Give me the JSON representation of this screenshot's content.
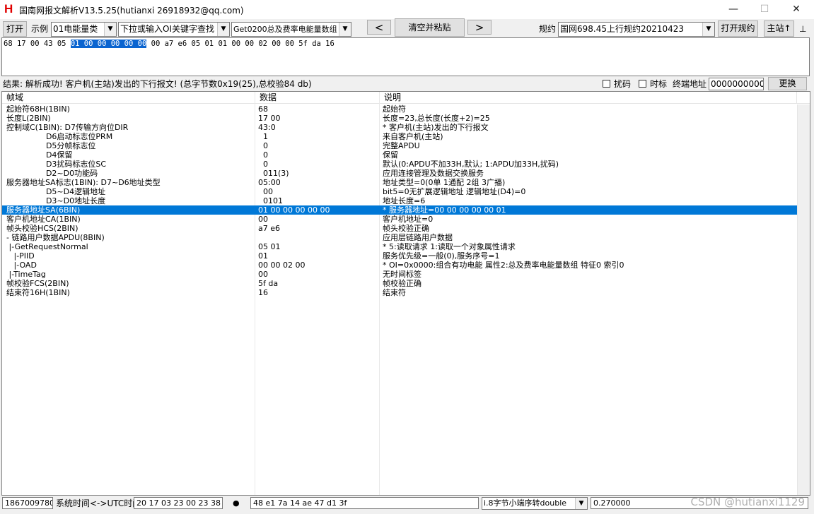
{
  "window": {
    "title": "国南网报文解析V13.5.25(hutianxi 26918932@qq.com)",
    "app_icon_letter": "H",
    "minimize": "—",
    "maximize": "☐",
    "close": "✕"
  },
  "toolbar": {
    "open_label": "打开",
    "example_label": "示例",
    "example_select": "01电能量类",
    "keyword_select": "下拉或输入OI关键字查找",
    "oi_select": "Get0200总及费率电能量数组",
    "prev_label": "<",
    "clear_paste_label": "清空并粘贴",
    "next_label": ">",
    "protocol_label": "规约",
    "protocol_select": "国网698.45上行规约20210423",
    "open_protocol_label": "打开规约",
    "master_label": "主站↑",
    "pin_label": "⊥"
  },
  "hex": {
    "before": "68 17 00 43 05 ",
    "selected": "01 00 00 00 00 00",
    "after": " 00 a7 e6 05 01 01 00 00 02 00 00 5f da 16"
  },
  "result": {
    "text": "结果: 解析成功! 客户机(主站)发出的下行报文! (总字节数0x19(25),总校验84 db)",
    "scramble_label": "扰码",
    "timetag_label": "时标",
    "terminal_addr_label": "终端地址",
    "terminal_addr_value": "000000000001",
    "replace_label": "更换"
  },
  "table": {
    "headers": [
      "帧域",
      "数据",
      "说明"
    ],
    "selected_index": 11,
    "rows": [
      [
        "起始符68H(1BIN)",
        "68",
        "起始符"
      ],
      [
        "长度L(2BIN)",
        "17 00",
        "长度=23,总长度(长度+2)=25"
      ],
      [
        "控制域C(1BIN): D7传输方向位DIR",
        "43:0",
        "* 客户机(主站)发出的下行报文"
      ],
      [
        "                D6启动标志位PRM",
        "  1",
        "来自客户机(主站)"
      ],
      [
        "                D5分帧标志位",
        "  0",
        "完整APDU"
      ],
      [
        "                D4保留",
        "  0",
        "保留"
      ],
      [
        "                D3扰码标志位SC",
        "  0",
        "默认(0:APDU不加33H,默认; 1:APDU加33H,扰码)"
      ],
      [
        "                D2~D0功能码",
        "  011(3)",
        "应用连接管理及数据交换服务"
      ],
      [
        "服务器地址SA标志(1BIN): D7~D6地址类型",
        "05:00",
        "地址类型=0(0单 1通配 2组 3广播)"
      ],
      [
        "                D5~D4逻辑地址",
        "  00",
        "bit5=0无扩展逻辑地址 逻辑地址(D4)=0"
      ],
      [
        "                D3~D0地址长度",
        "  0101",
        "地址长度=6"
      ],
      [
        "服务器地址SA(6BIN)",
        "01 00 00 00 00 00",
        "* 服务器地址=00 00 00 00 00 01"
      ],
      [
        "客户机地址CA(1BIN)",
        "00",
        "客户机地址=0"
      ],
      [
        "帧头校验HCS(2BIN)",
        "a7 e6",
        "帧头校验正确"
      ],
      [
        "- 链路用户数据APDU(8BIN)",
        "",
        "应用层链路用户数据"
      ],
      [
        " |-GetRequestNormal",
        "05 01",
        "* 5:读取请求 1:读取一个对象属性请求"
      ],
      [
        "   |-PIID",
        "01",
        "服务优先级=一般(0),服务序号=1"
      ],
      [
        "   |-OAD",
        "00 00 02 00",
        "* OI=0x0000:组合有功电能 属性2:总及费率电能量数组 特征0 索引0"
      ],
      [
        " |-TimeTag",
        "00",
        "无时间标签"
      ],
      [
        "帧校验FCS(2BIN)",
        "5f da",
        "帧校验正确"
      ],
      [
        "结束符16H(1BIN)",
        "16",
        "结束符"
      ]
    ]
  },
  "status": {
    "phone": "18670097802",
    "convert_label": "系统时间<->UTC时间",
    "time_hex": "20 17 03 23 00 23 38",
    "dot": "●",
    "double_hex": "48 e1 7a 14 ae 47 d1 3f",
    "convert_select": "i.8字节小端序转double",
    "double_value": "0.270000"
  },
  "watermark": "CSDN @hutianxi1129"
}
